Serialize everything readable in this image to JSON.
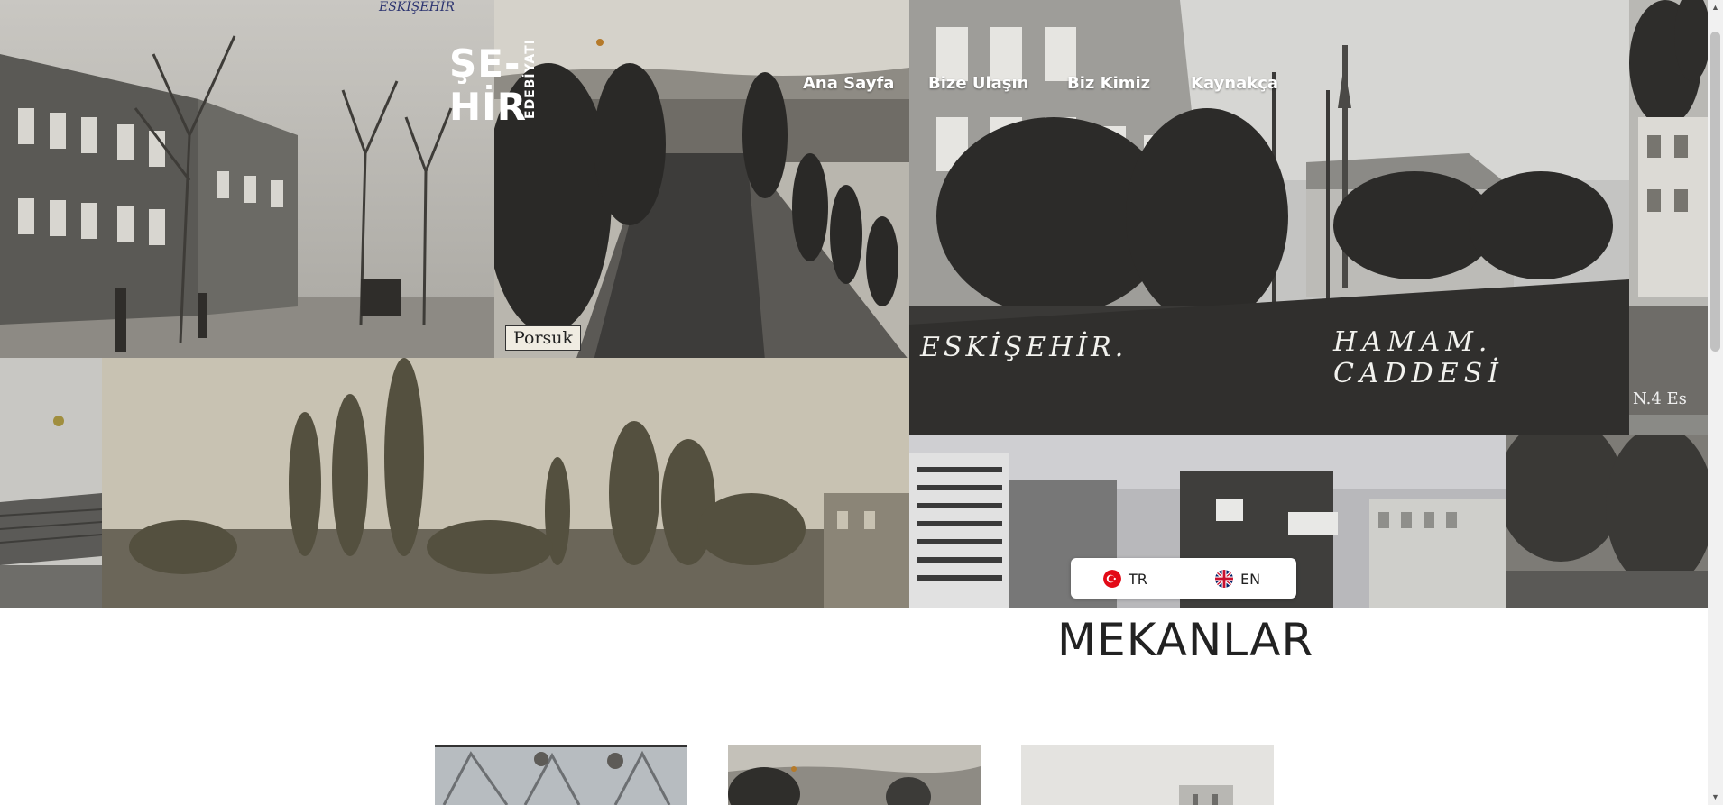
{
  "brand": {
    "logo_line1": "ŞE-",
    "logo_line2": "HİR",
    "logo_sub": "EDEBİYATI"
  },
  "nav": {
    "home": "Ana Sayfa",
    "contact": "Bize Ulaşın",
    "about": "Biz Kimiz",
    "references": "Kaynakça"
  },
  "hero": {
    "photo_captions": {
      "porsuk": "Porsuk",
      "eskisehir": "ESKİŞEHİR.",
      "hamam": "HAMAM. CADDESİ",
      "corner_top": "ESKİŞEHİR",
      "corner_right": "N.4 Es"
    }
  },
  "language": {
    "tr_label": "TR",
    "en_label": "EN"
  },
  "section": {
    "title": "MEKANLAR"
  },
  "icons": {
    "tr_flag": "turkey-flag-icon",
    "en_flag": "uk-flag-icon",
    "scroll_up": "scroll-up-arrow-icon",
    "scroll_down": "scroll-down-arrow-icon"
  },
  "colors": {
    "background": "#ffffff",
    "nav_text": "#ffffff",
    "title_text": "#222222",
    "lang_box": "#ffffff"
  }
}
